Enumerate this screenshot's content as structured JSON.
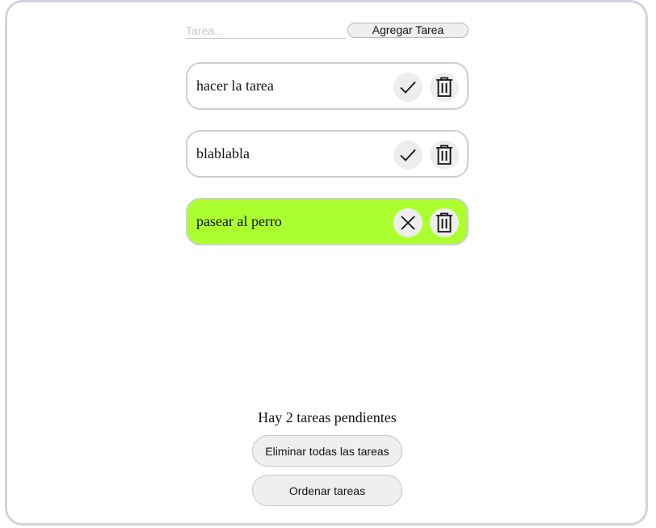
{
  "form": {
    "placeholder": "Tarea...",
    "value": "",
    "add_label": "Agregar Tarea"
  },
  "tasks": [
    {
      "text": "hacer la tarea",
      "completed": false,
      "toggle_icon": "check-icon"
    },
    {
      "text": "blablabla",
      "completed": false,
      "toggle_icon": "check-icon"
    },
    {
      "text": "pasear al perro",
      "completed": true,
      "toggle_icon": "x-icon"
    }
  ],
  "footer": {
    "pending_text": "Hay 2 tareas pendientes",
    "delete_all_label": "Eliminar todas las tareas",
    "sort_label": "Ordenar tareas"
  },
  "colors": {
    "completed_bg": "#acff2f",
    "border": "#cfcfcf",
    "icon_bg": "#ededed"
  }
}
